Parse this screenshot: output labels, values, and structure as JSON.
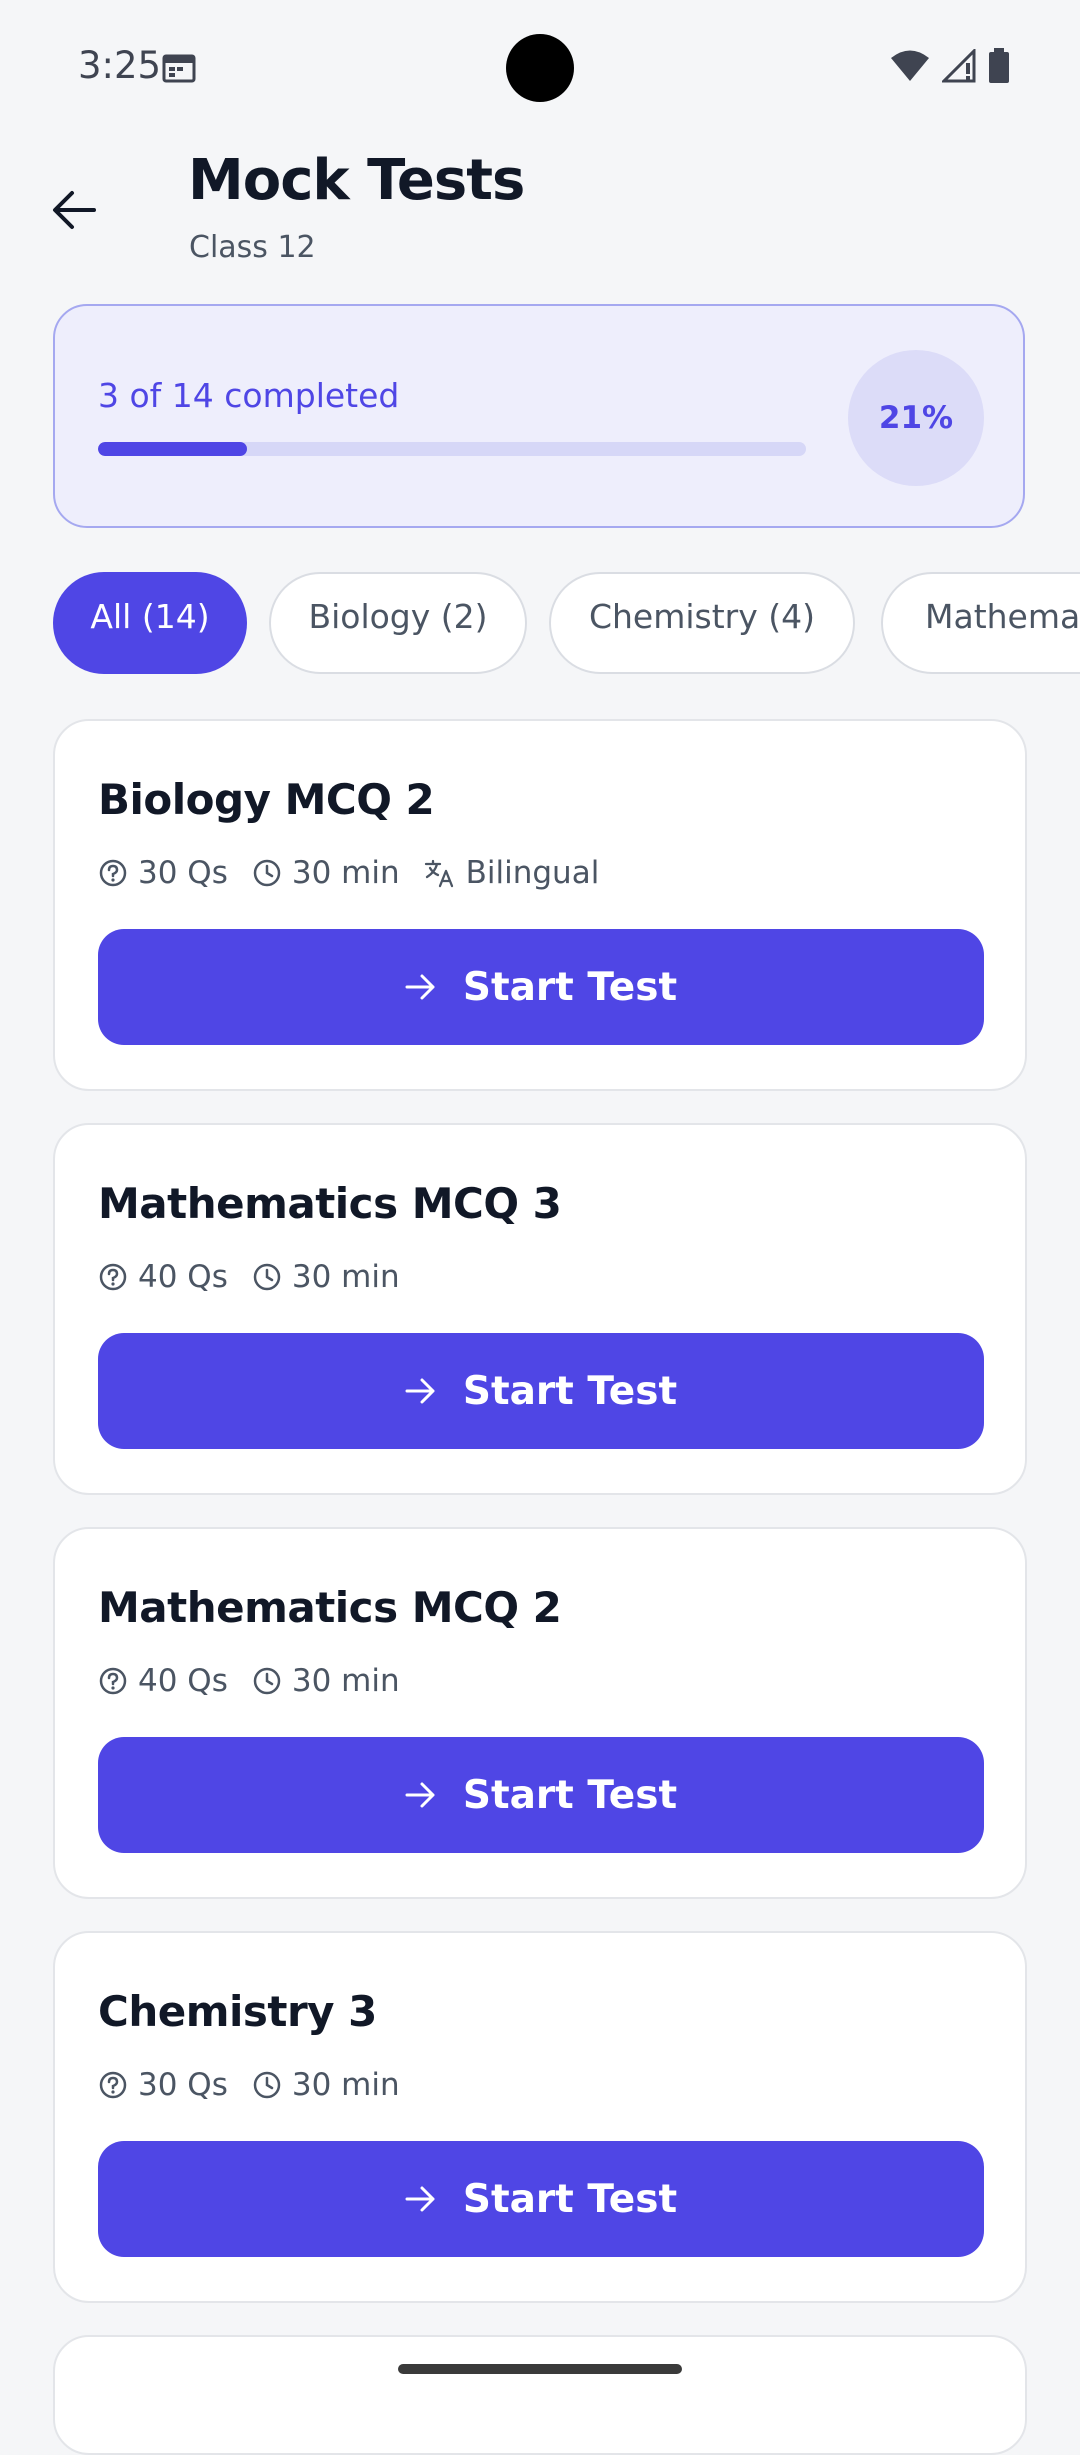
{
  "status_bar": {
    "time": "3:25"
  },
  "header": {
    "title": "Mock Tests",
    "subtitle": "Class 12"
  },
  "progress": {
    "label": "3 of 14 completed",
    "percent_label": "21%",
    "fraction": 0.21,
    "accent": "#4F46E5"
  },
  "filters": [
    {
      "label": "All (14)",
      "active": true
    },
    {
      "label": "Biology (2)",
      "active": false
    },
    {
      "label": "Chemistry (4)",
      "active": false
    },
    {
      "label": "Mathematics",
      "active": false
    }
  ],
  "tests": [
    {
      "title": "Biology MCQ 2",
      "questions": "30 Qs",
      "duration": "30 min",
      "language": "Bilingual",
      "button": "Start Test"
    },
    {
      "title": "Mathematics MCQ 3",
      "questions": "40 Qs",
      "duration": "30 min",
      "button": "Start Test"
    },
    {
      "title": "Mathematics MCQ 2",
      "questions": "40 Qs",
      "duration": "30 min",
      "button": "Start Test"
    },
    {
      "title": "Chemistry 3",
      "questions": "30 Qs",
      "duration": "30 min",
      "button": "Start Test"
    }
  ],
  "icons": {
    "back": "arrow-left-icon",
    "questions": "help-circle-icon",
    "duration": "clock-icon",
    "language": "translate-icon",
    "start": "arrow-right-icon",
    "calendar": "calendar-icon",
    "wifi": "wifi-icon",
    "signal": "signal-icon",
    "battery": "battery-icon"
  },
  "colors": {
    "primary": "#4F46E5",
    "background": "#F5F6F8",
    "card": "#FFFFFF",
    "progress_bg": "#EEEEFC"
  }
}
